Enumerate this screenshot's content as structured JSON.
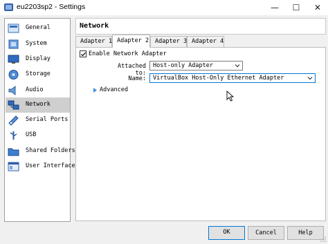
{
  "window": {
    "title": "eu2203sp2 - Settings",
    "minimize": "—",
    "maximize": "☐",
    "close": "✕"
  },
  "sidebar": {
    "items": [
      {
        "label": "General",
        "icon": "general-icon"
      },
      {
        "label": "System",
        "icon": "system-icon"
      },
      {
        "label": "Display",
        "icon": "display-icon"
      },
      {
        "label": "Storage",
        "icon": "storage-icon"
      },
      {
        "label": "Audio",
        "icon": "audio-icon"
      },
      {
        "label": "Network",
        "icon": "network-icon",
        "selected": true
      },
      {
        "label": "Serial Ports",
        "icon": "serial-ports-icon"
      },
      {
        "label": "USB",
        "icon": "usb-icon"
      },
      {
        "label": "Shared Folders",
        "icon": "shared-folders-icon"
      },
      {
        "label": "User Interface",
        "icon": "user-interface-icon"
      }
    ]
  },
  "page": {
    "title": "Network"
  },
  "tabs": [
    "Adapter 1",
    "Adapter 2",
    "Adapter 3",
    "Adapter 4"
  ],
  "active_tab": "Adapter 2",
  "adapter": {
    "enable_label": "Enable Network Adapter",
    "enabled": true,
    "attached_label": "Attached to:",
    "attached_value": "Host-only Adapter",
    "name_label": "Name:",
    "name_value": "VirtualBox Host-Only Ethernet Adapter",
    "advanced_label": "Advanced"
  },
  "buttons": {
    "ok": "OK",
    "cancel": "Cancel",
    "help": "Help"
  },
  "colors": {
    "accent": "#0078d7",
    "selected_bg": "#cfcfcf",
    "dialog_bg": "#f0f0f0"
  }
}
